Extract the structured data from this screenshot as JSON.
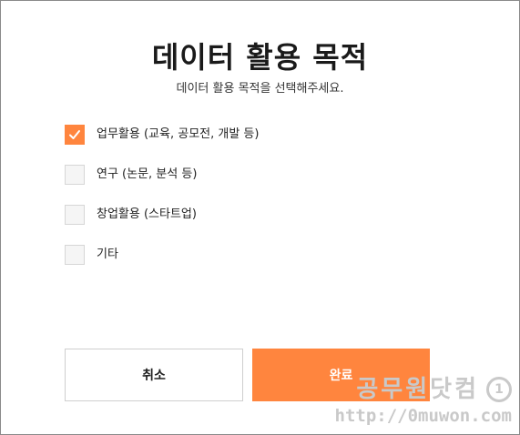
{
  "dialog": {
    "title": "데이터 활용 목적",
    "subtitle": "데이터 활용 목적을 선택해주세요.",
    "accent_color": "#ff853e",
    "options": [
      {
        "label": "업무활용 (교육, 공모전, 개발 등)",
        "checked": true
      },
      {
        "label": "연구 (논문, 분석 등)",
        "checked": false
      },
      {
        "label": "창업활용 (스타트업)",
        "checked": false
      },
      {
        "label": "기타",
        "checked": false
      }
    ],
    "buttons": {
      "cancel_label": "취소",
      "done_label": "완료"
    }
  },
  "watermark": {
    "site_name": "공무원닷컴",
    "logo_glyph": "1",
    "url": "http://0muwon.com"
  }
}
